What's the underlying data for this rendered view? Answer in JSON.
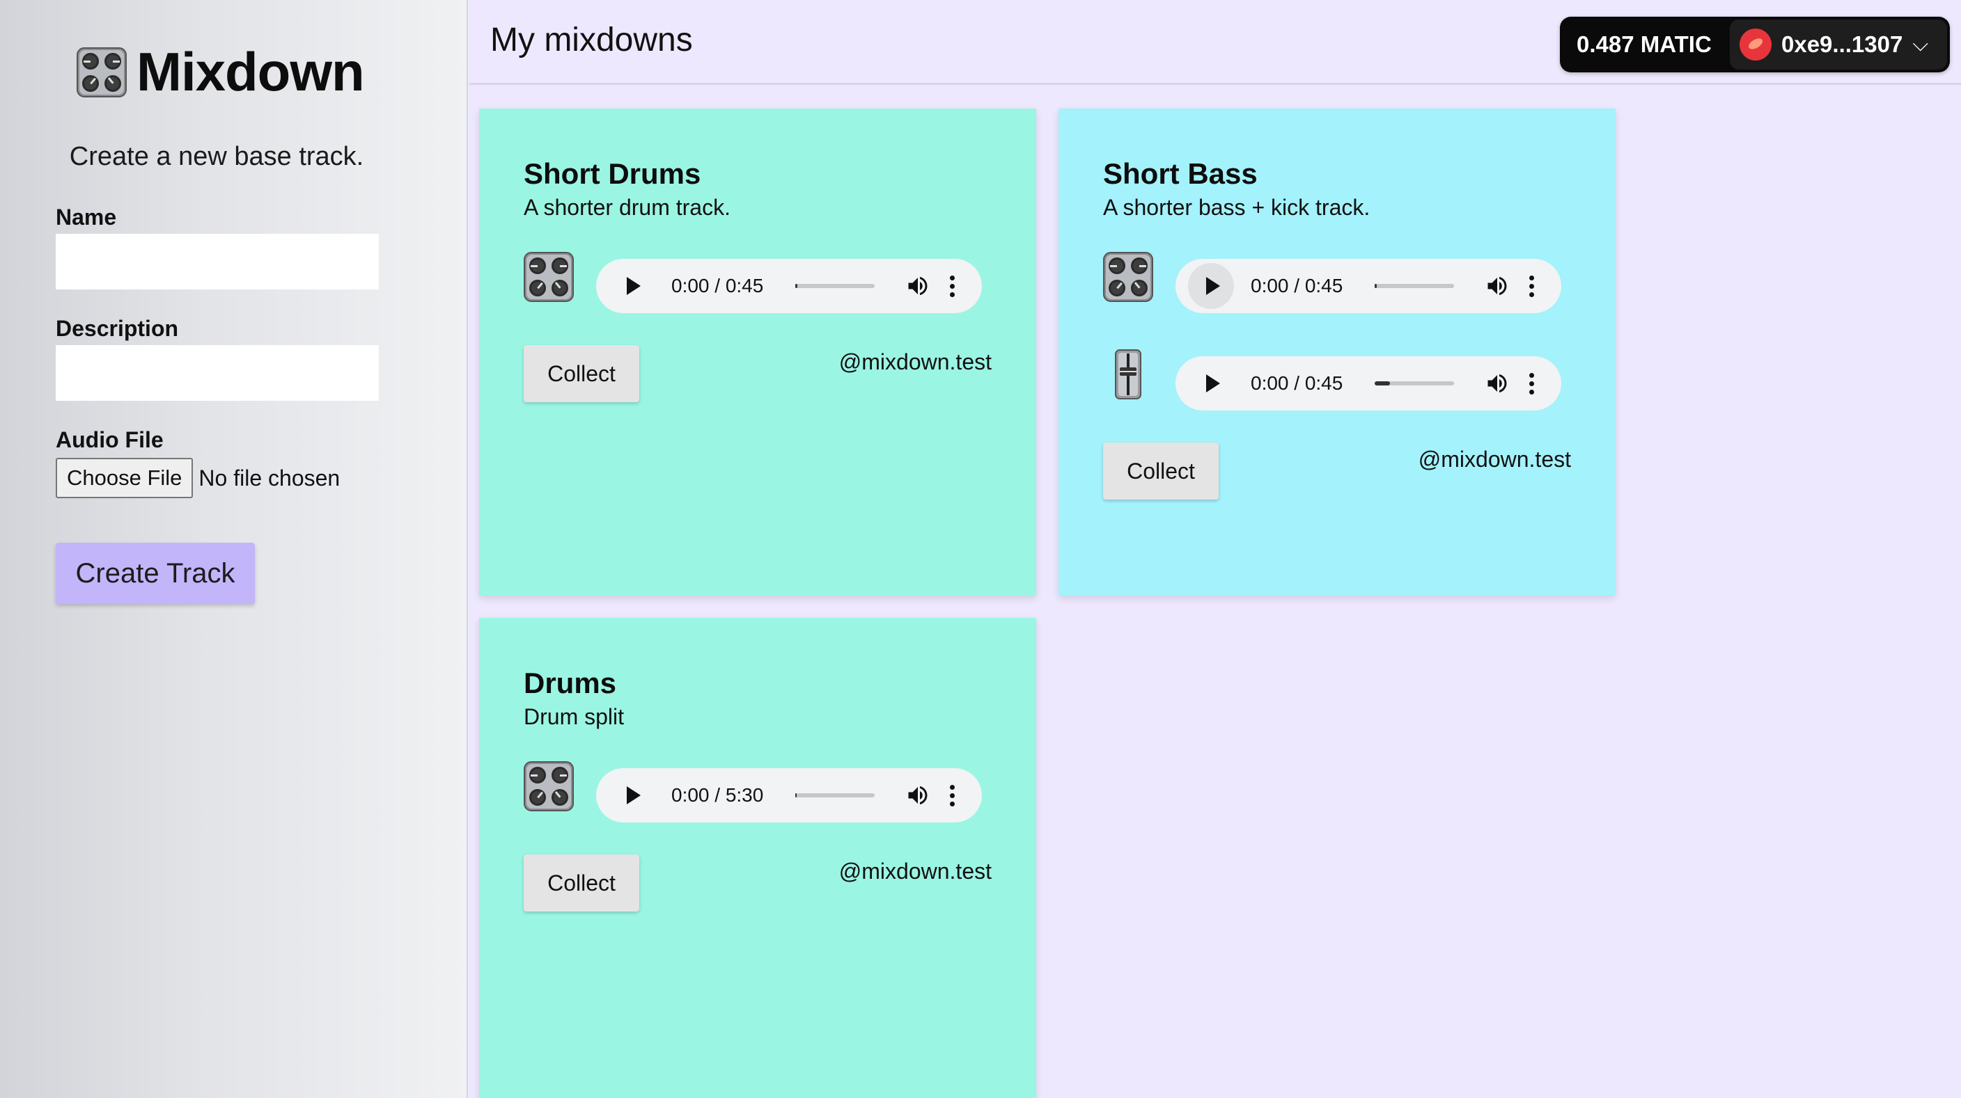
{
  "sidebar": {
    "logo_text": "Mixdown",
    "heading": "Create a new base track.",
    "name_label": "Name",
    "name_value": "",
    "description_label": "Description",
    "description_value": "",
    "audio_label": "Audio File",
    "choose_file_label": "Choose File",
    "no_file_text": "No file chosen",
    "create_button": "Create Track"
  },
  "header": {
    "title": "My mixdowns",
    "balance": "0.487 MATIC",
    "address": "0xe9...1307"
  },
  "cards": [
    {
      "title": "Short Drums",
      "description": "A shorter drum track.",
      "color": "#9bf5e3",
      "tracks": [
        {
          "icon": "mixer-knobs-icon",
          "time": "0:00 / 0:45",
          "progress": 0.02
        }
      ],
      "collect_label": "Collect",
      "handle": "@mixdown.test"
    },
    {
      "title": "Short Bass",
      "description": "A shorter bass + kick track.",
      "color": "#a4f2fb",
      "tracks": [
        {
          "icon": "mixer-knobs-icon",
          "time": "0:00 / 0:45",
          "progress": 0.02
        },
        {
          "icon": "fader-icon",
          "time": "0:00 / 0:45",
          "progress": 0.2
        }
      ],
      "collect_label": "Collect",
      "handle": "@mixdown.test"
    },
    {
      "title": "Drums",
      "description": "Drum split",
      "color": "#9bf5e3",
      "tracks": [
        {
          "icon": "mixer-knobs-icon",
          "time": "0:00 / 5:30",
          "progress": 0.01
        }
      ],
      "collect_label": "Collect",
      "handle": "@mixdown.test"
    }
  ]
}
